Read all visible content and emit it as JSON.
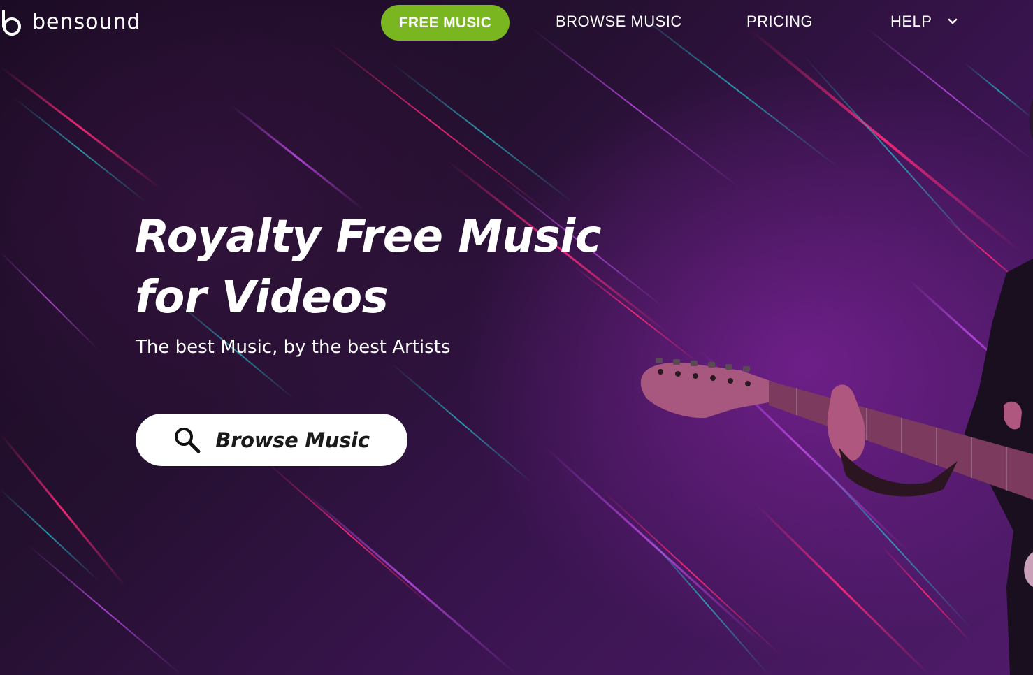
{
  "brand": {
    "name": "bensound",
    "icon": "bensound-logo-icon"
  },
  "nav": {
    "free_music": "FREE MUSIC",
    "browse_music": "BROWSE MUSIC",
    "pricing": "PRICING",
    "help": "HELP",
    "help_icon": "chevron-down-icon"
  },
  "hero": {
    "title_line1": "Royalty Free Music",
    "title_line2": "for Videos",
    "subtitle": "The best Music, by the best Artists",
    "cta_label": "Browse Music",
    "cta_icon": "search-icon"
  },
  "colors": {
    "accent_green": "#7ab61f",
    "background_dark": "#1b0b24",
    "background_purple": "#4f1b6a",
    "streak_pink": "#e0206a",
    "streak_teal": "#2aa7b8",
    "streak_violet": "#b03ad8"
  }
}
